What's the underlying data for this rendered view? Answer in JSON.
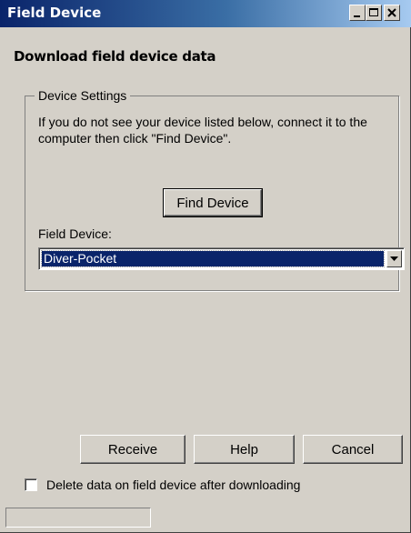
{
  "window": {
    "title": "Field Device",
    "header": "Download field device data"
  },
  "device_settings": {
    "group_label": "Device Settings",
    "description": "If you do not see your device listed below, connect it to the computer then click \"Find Device\".",
    "find_device_label": "Find Device",
    "field_device_label": "Field Device:",
    "field_device_value": "Diver-Pocket"
  },
  "buttons": {
    "receive": "Receive",
    "help": "Help",
    "cancel": "Cancel"
  },
  "options": {
    "delete_after_download_label": "Delete data on field device after downloading",
    "delete_after_download_checked": false
  },
  "status": {
    "text": ""
  }
}
